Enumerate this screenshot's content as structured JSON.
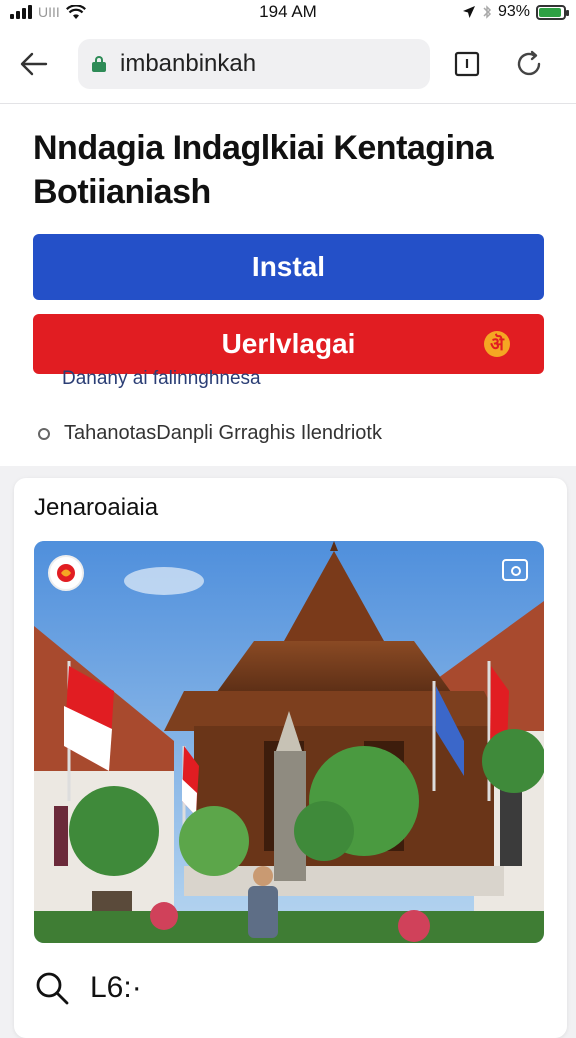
{
  "status_bar": {
    "carrier": "UIII",
    "time": "194 AM",
    "battery": "93%",
    "battery_level": 0.93
  },
  "browser": {
    "url": "imbanbinkah",
    "icons": [
      "back-arrow-icon",
      "lock-icon",
      "tabs-icon",
      "reload-icon"
    ]
  },
  "page": {
    "title": "Nndagia Indaglkiai Kentagina Botiianiash",
    "install_label": "Instal",
    "secondary_label": "Uerlvlagai",
    "sub_link": "Danany ai falinnghnesa",
    "info_text": "TahanotasDanpli Grraghis Ilendriotk",
    "colors": {
      "install": "#2450c8",
      "secondary": "#e11d22",
      "secondary_icon": "#f5a623"
    }
  },
  "feature": {
    "section_title": "Jenaroaiaia",
    "photo_icons": [
      "emblem-icon",
      "camera-icon"
    ],
    "bottom_label": "L6:·"
  }
}
